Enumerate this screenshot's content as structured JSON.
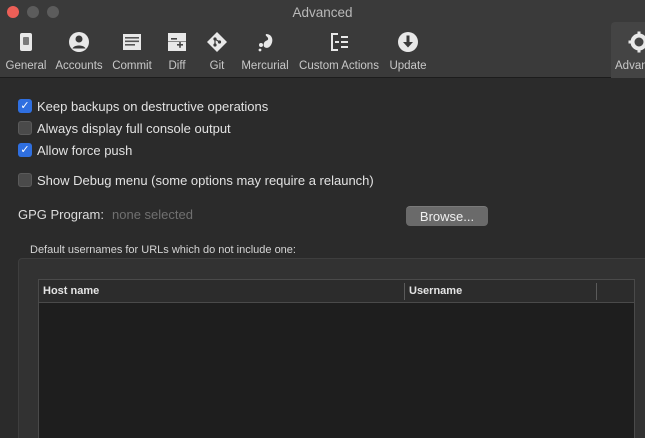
{
  "window": {
    "title": "Advanced"
  },
  "toolbar": {
    "items": [
      {
        "label": "General",
        "icon": "general-icon"
      },
      {
        "label": "Accounts",
        "icon": "accounts-icon"
      },
      {
        "label": "Commit",
        "icon": "commit-icon"
      },
      {
        "label": "Diff",
        "icon": "diff-icon"
      },
      {
        "label": "Git",
        "icon": "git-icon"
      },
      {
        "label": "Mercurial",
        "icon": "mercurial-icon"
      },
      {
        "label": "Custom Actions",
        "icon": "custom-actions-icon"
      },
      {
        "label": "Update",
        "icon": "update-icon"
      },
      {
        "label": "Advanced",
        "icon": "gear-icon"
      }
    ]
  },
  "options": {
    "keep_backups": {
      "label": "Keep backups on destructive operations",
      "checked": true
    },
    "full_console": {
      "label": "Always display full console output",
      "checked": false
    },
    "force_push": {
      "label": "Allow force push",
      "checked": true
    },
    "debug_menu": {
      "label": "Show Debug menu (some options may require a relaunch)",
      "checked": false
    }
  },
  "gpg": {
    "label": "GPG Program:",
    "value": "none selected",
    "browse_label": "Browse..."
  },
  "usernames": {
    "caption": "Default usernames for URLs which do not include one:",
    "columns": [
      "Host name",
      "Username"
    ],
    "rows": []
  },
  "colors": {
    "accent": "#2f6fe0",
    "close": "#ec5f57"
  }
}
